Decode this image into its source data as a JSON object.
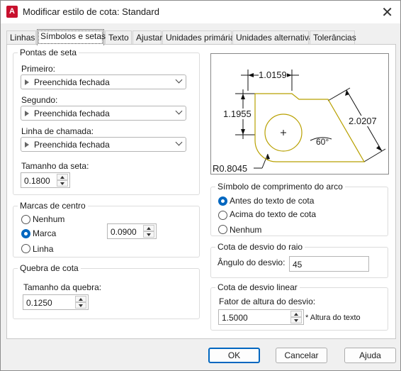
{
  "window": {
    "title": "Modificar estilo de cota: Standard",
    "app_icon_text": "A"
  },
  "tabs": [
    "Linhas",
    "Símbolos e setas",
    "Texto",
    "Ajustar",
    "Unidades primárias",
    "Unidades alternativas",
    "Tolerâncias"
  ],
  "active_tab": "Símbolos e setas",
  "arrowheads": {
    "group_label": "Pontas de seta",
    "first_label": "Primeiro:",
    "first_value": "Preenchida fechada",
    "second_label": "Segundo:",
    "second_value": "Preenchida fechada",
    "leader_label": "Linha de chamada:",
    "leader_value": "Preenchida fechada",
    "size_label": "Tamanho da seta:",
    "size_value": "0.1800"
  },
  "center_marks": {
    "group_label": "Marcas de centro",
    "options": [
      "Nenhum",
      "Marca",
      "Linha"
    ],
    "selected": "Marca",
    "size_value": "0.0900"
  },
  "dimension_break": {
    "group_label": "Quebra de cota",
    "size_label": "Tamanho da quebra:",
    "size_value": "0.1250"
  },
  "preview": {
    "dim_top": "1.0159",
    "dim_left": "1.1955",
    "dim_right": "2.0207",
    "angle": "60°",
    "radius": "R0.8045"
  },
  "arc_length": {
    "group_label": "Símbolo de comprimento do arco",
    "options": [
      "Antes do texto de cota",
      "Acima do texto de cota",
      "Nenhum"
    ],
    "selected": "Antes do texto de cota"
  },
  "radius_jog": {
    "group_label": "Cota de desvio do raio",
    "angle_label": "Ângulo do desvio:",
    "angle_value": "45"
  },
  "linear_jog": {
    "group_label": "Cota de desvio linear",
    "factor_label": "Fator de altura do desvio:",
    "factor_value": "1.5000",
    "suffix": "* Altura do texto"
  },
  "buttons": {
    "ok": "OK",
    "cancel": "Cancelar",
    "help": "Ajuda"
  },
  "colors": {
    "accent": "#0067c0",
    "app_red": "#c8102e",
    "preview_shape": "#b8a000"
  }
}
